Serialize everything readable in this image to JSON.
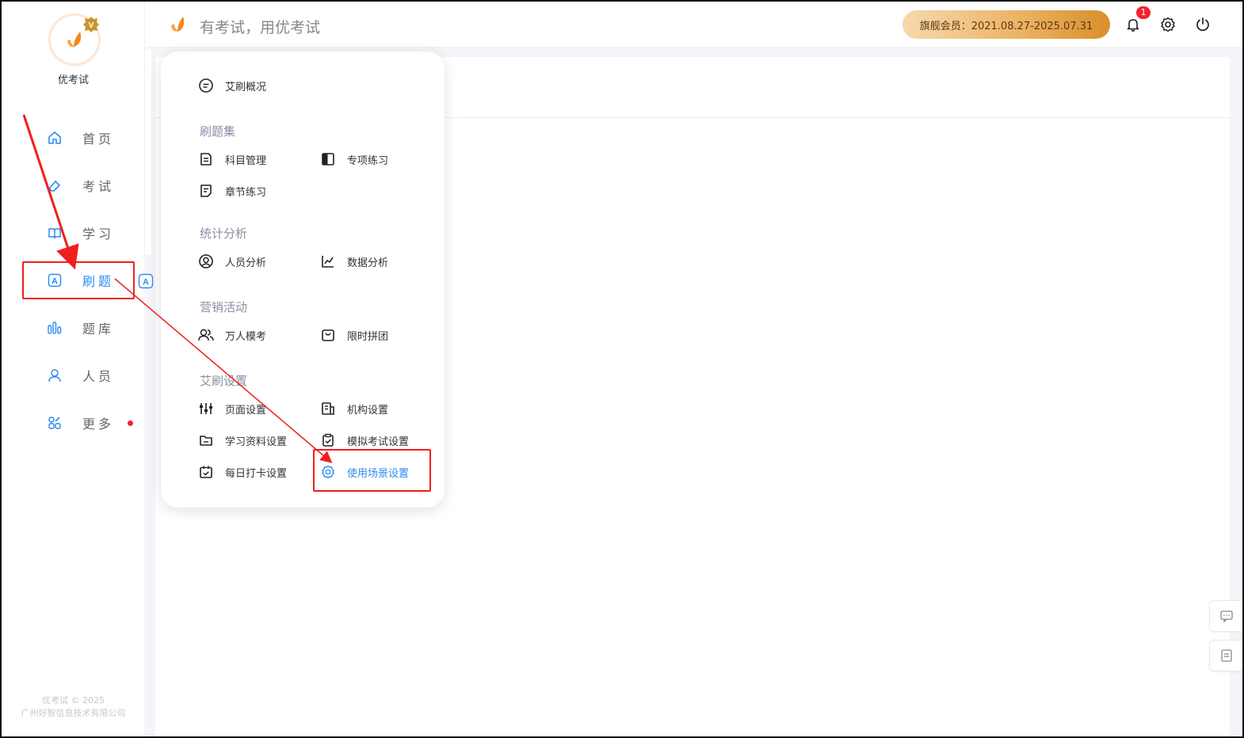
{
  "sidebar": {
    "brand_name": "优考试",
    "items": [
      {
        "label": "首页",
        "icon": "home-icon"
      },
      {
        "label": "考试",
        "icon": "eraser-icon"
      },
      {
        "label": "学习",
        "icon": "book-icon"
      },
      {
        "label": "刷题",
        "icon": "letter-a-icon",
        "active": true
      },
      {
        "label": "题库",
        "icon": "bars-icon"
      },
      {
        "label": "人员",
        "icon": "user-icon"
      },
      {
        "label": "更多",
        "icon": "apps-icon",
        "dot": true
      }
    ],
    "copyright_line1": "优考试 © 2025",
    "copyright_line2": "广州好智信息技术有限公司"
  },
  "header": {
    "slogan": "有考试，用优考试",
    "member_badge": "旗舰会员：2021.08.27-2025.07.31",
    "notification_count": "1"
  },
  "popup": {
    "overview": "艾刷概况",
    "sections": [
      {
        "title": "刷题集",
        "items": [
          "科目管理",
          "专项练习",
          "章节练习"
        ]
      },
      {
        "title": "统计分析",
        "items": [
          "人员分析",
          "数据分析"
        ]
      },
      {
        "title": "营销活动",
        "items": [
          "万人模考",
          "限时拼团"
        ]
      },
      {
        "title": "艾刷设置",
        "items": [
          "页面设置",
          "机构设置",
          "学习资料设置",
          "模拟考试设置",
          "每日打卡设置",
          "使用场景设置"
        ]
      }
    ]
  },
  "colors": {
    "accent": "#2d8cf0",
    "annotation_red": "#f01e1e",
    "member_gold": "#ecb466"
  }
}
